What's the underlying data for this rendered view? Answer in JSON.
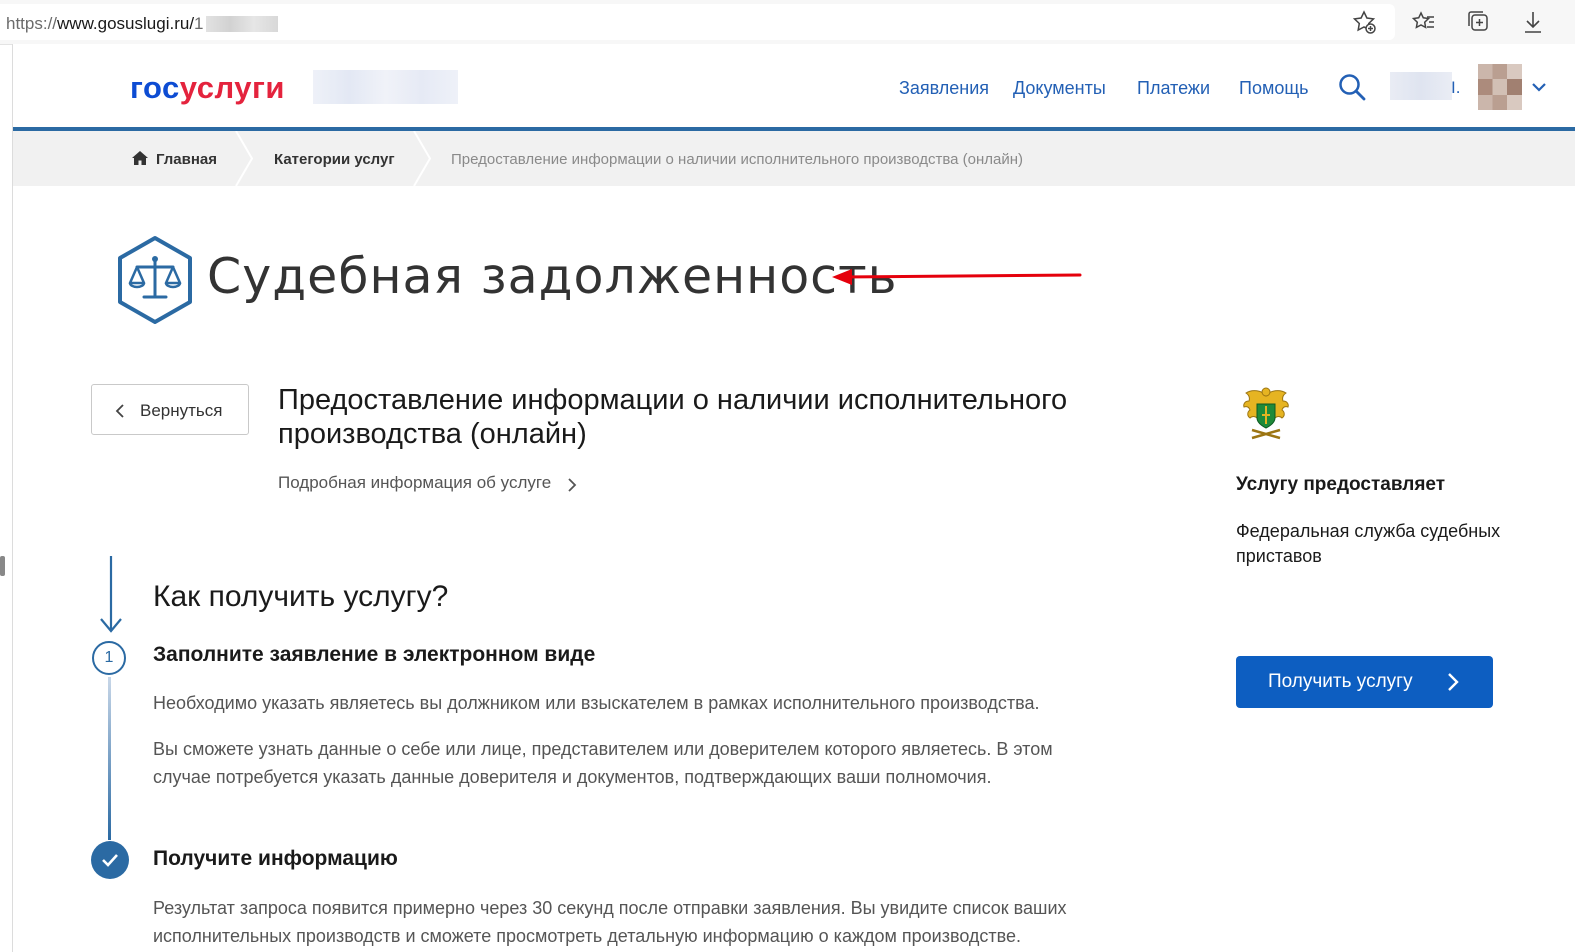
{
  "browser": {
    "url_scheme": "https://",
    "url_host": "www.gosuslugi.ru/",
    "url_path_first_char": "1"
  },
  "header": {
    "logo_part1": "гос",
    "logo_part2": "услуги",
    "nav": [
      "Заявления",
      "Документы",
      "Платежи",
      "Помощь"
    ],
    "user_suffix": "I."
  },
  "breadcrumb": {
    "home": "Главная",
    "categories": "Категории услуг",
    "current": "Предоставление информации о наличии исполнительного производства (онлайн)"
  },
  "category": {
    "title": "Судебная задолженность"
  },
  "service": {
    "back_label": "Вернуться",
    "title": "Предоставление информации о наличии исполнительного производства (онлайн)",
    "more_info": "Подробная информация об услуге"
  },
  "provider": {
    "heading": "Услугу предоставляет",
    "name": "Федеральная служба судебных приставов",
    "get_button": "Получить услугу"
  },
  "steps": {
    "heading": "Как получить услугу?",
    "items": [
      {
        "number": "1",
        "title": "Заполните заявление в электронном виде",
        "text1": "Необходимо указать являетесь вы должником или взыскателем в рамках исполнительного производства.",
        "text2": "Вы сможете узнать данные о себе или лице, представителем или доверителем которого являетесь. В этом случае потребуется указать данные доверителя и документов, подтверждающих ваши полномочия."
      },
      {
        "title": "Получите информацию",
        "text1": "Результат запроса появится примерно через 30 секунд после отправки заявления. Вы увидите список ваших исполнительных производств и сможете просмотреть детальную информацию о каждом производстве."
      }
    ]
  },
  "colors": {
    "brand_blue": "#0d4cd3",
    "brand_red": "#e4233d",
    "link_blue": "#2360b5",
    "accent_blue": "#2b6aa3",
    "button_blue": "#0d5ec1",
    "annotation_red": "#e5000c"
  }
}
